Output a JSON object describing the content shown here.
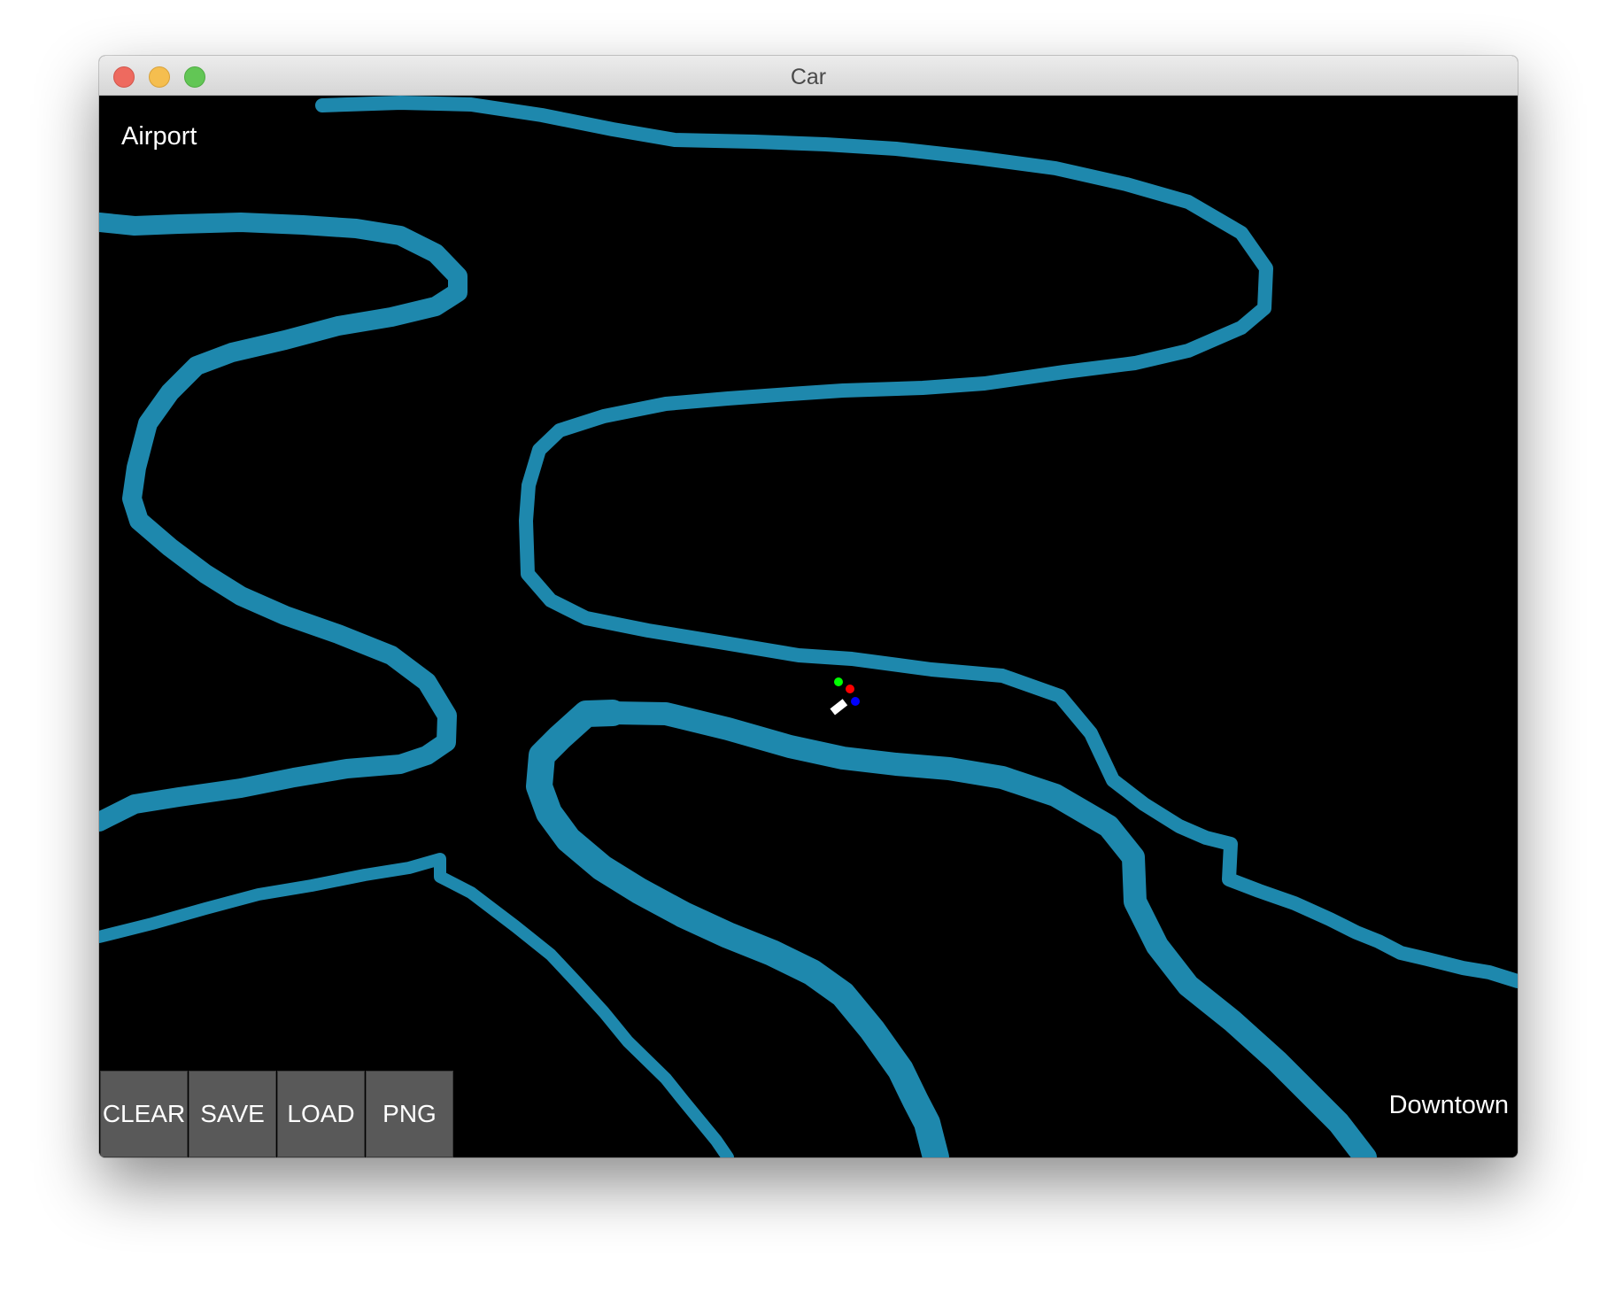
{
  "window": {
    "title": "Car"
  },
  "canvas": {
    "labels": {
      "top_left": "Airport",
      "bottom_right": "Downtown"
    },
    "road_color": "#1e88ad",
    "background_color": "#000000",
    "car": {
      "body_color": "#ffffff",
      "sensor_colors": [
        "#00ff00",
        "#ff0000",
        "#0000ff"
      ]
    }
  },
  "toolbar": {
    "clear_label": "CLEAR",
    "save_label": "SAVE",
    "load_label": "LOAD",
    "png_label": "PNG"
  }
}
